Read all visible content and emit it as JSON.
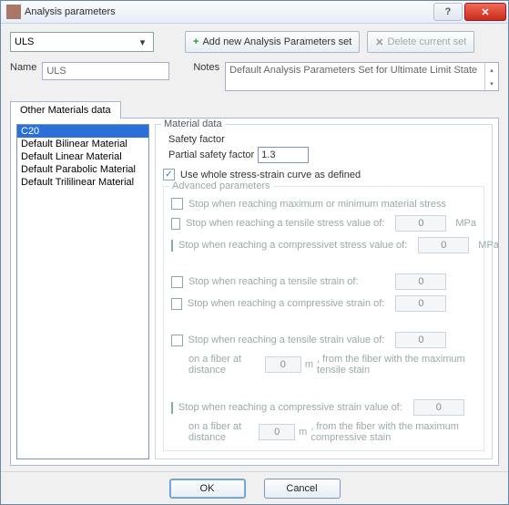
{
  "window": {
    "title": "Analysis parameters",
    "help_glyph": "?",
    "close_glyph": "✕"
  },
  "toolbar": {
    "set_selected": "ULS",
    "add_label": "Add new Analysis Parameters set",
    "delete_label": "Delete current set"
  },
  "fields": {
    "name_label": "Name",
    "name_value": "ULS",
    "notes_label": "Notes",
    "notes_value": "Default Analysis Parameters Set for Ultimate Limit State"
  },
  "tabs": {
    "other_materials": "Other Materials data"
  },
  "materials_list": [
    "C20",
    "Default Bilinear Material",
    "Default Linear Material",
    "Default Parabolic Material",
    "Default Trililinear Material"
  ],
  "material_data": {
    "legend": "Material data",
    "safety_factor_label": "Safety factor",
    "partial_safety_label": "Partial safety factor",
    "partial_safety_value": "1.3",
    "use_whole_curve_label": "Use whole stress-strain curve as defined",
    "use_whole_curve_checked": "✓"
  },
  "advanced": {
    "legend": "Advanced parameters",
    "stop_max_min_stress": "Stop when reaching maximum or minimum material stress",
    "stop_tensile_stress": "Stop when reaching a tensile stress value of:",
    "stop_compressive_stress": "Stop when reaching a compressivet stress value of:",
    "stop_tensile_strain": "Stop when reaching a tensile strain of:",
    "stop_compressive_strain": "Stop when reaching a compressive strain of:",
    "stop_tensile_strain_value": "Stop when reaching a tensile strain value of:",
    "stop_compressive_strain_value": "Stop when reaching a compressive strain value of:",
    "fiber_distance_prefix": "on a fiber at distance",
    "fiber_tensile_suffix": ", from the fiber with the maximum tensile stain",
    "fiber_compressive_suffix": ", from the fiber with the maximum compressive stain",
    "unit_mpa": "MPa",
    "unit_m": "m",
    "zero": "0"
  },
  "footer": {
    "ok": "OK",
    "cancel": "Cancel"
  }
}
